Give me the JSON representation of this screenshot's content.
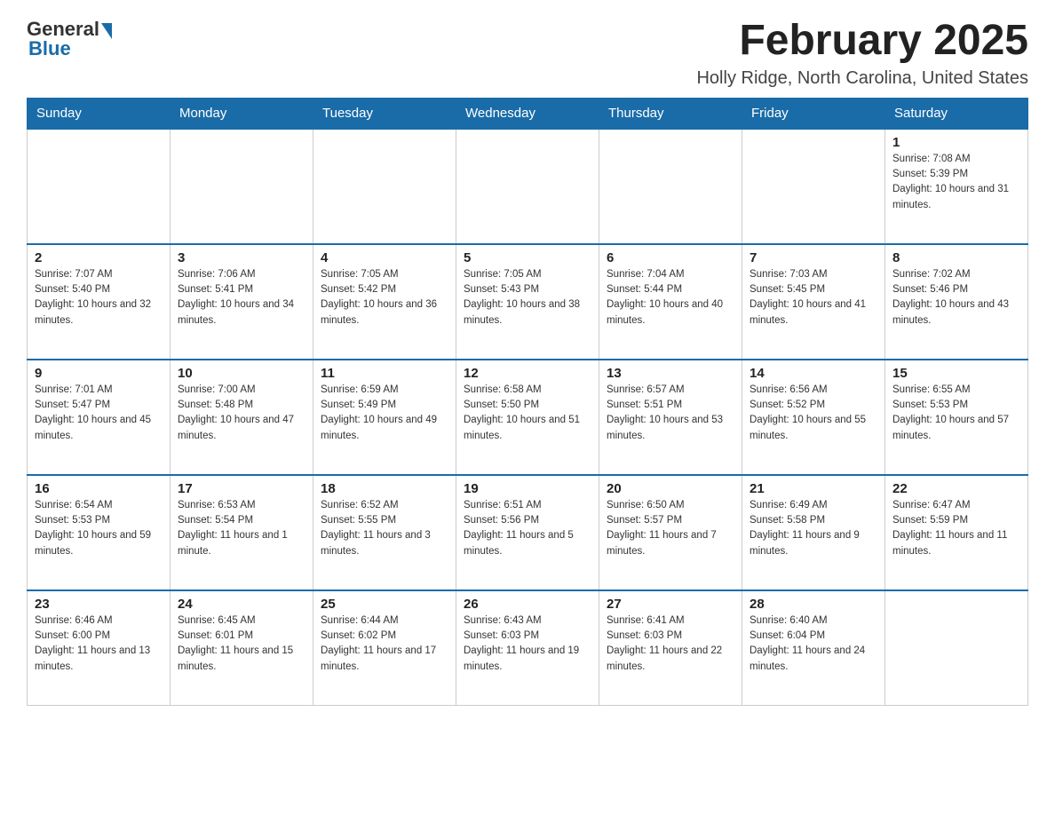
{
  "logo": {
    "general": "General",
    "blue": "Blue"
  },
  "header": {
    "month": "February 2025",
    "location": "Holly Ridge, North Carolina, United States"
  },
  "weekdays": [
    "Sunday",
    "Monday",
    "Tuesday",
    "Wednesday",
    "Thursday",
    "Friday",
    "Saturday"
  ],
  "weeks": [
    [
      {
        "day": "",
        "info": ""
      },
      {
        "day": "",
        "info": ""
      },
      {
        "day": "",
        "info": ""
      },
      {
        "day": "",
        "info": ""
      },
      {
        "day": "",
        "info": ""
      },
      {
        "day": "",
        "info": ""
      },
      {
        "day": "1",
        "info": "Sunrise: 7:08 AM\nSunset: 5:39 PM\nDaylight: 10 hours and 31 minutes."
      }
    ],
    [
      {
        "day": "2",
        "info": "Sunrise: 7:07 AM\nSunset: 5:40 PM\nDaylight: 10 hours and 32 minutes."
      },
      {
        "day": "3",
        "info": "Sunrise: 7:06 AM\nSunset: 5:41 PM\nDaylight: 10 hours and 34 minutes."
      },
      {
        "day": "4",
        "info": "Sunrise: 7:05 AM\nSunset: 5:42 PM\nDaylight: 10 hours and 36 minutes."
      },
      {
        "day": "5",
        "info": "Sunrise: 7:05 AM\nSunset: 5:43 PM\nDaylight: 10 hours and 38 minutes."
      },
      {
        "day": "6",
        "info": "Sunrise: 7:04 AM\nSunset: 5:44 PM\nDaylight: 10 hours and 40 minutes."
      },
      {
        "day": "7",
        "info": "Sunrise: 7:03 AM\nSunset: 5:45 PM\nDaylight: 10 hours and 41 minutes."
      },
      {
        "day": "8",
        "info": "Sunrise: 7:02 AM\nSunset: 5:46 PM\nDaylight: 10 hours and 43 minutes."
      }
    ],
    [
      {
        "day": "9",
        "info": "Sunrise: 7:01 AM\nSunset: 5:47 PM\nDaylight: 10 hours and 45 minutes."
      },
      {
        "day": "10",
        "info": "Sunrise: 7:00 AM\nSunset: 5:48 PM\nDaylight: 10 hours and 47 minutes."
      },
      {
        "day": "11",
        "info": "Sunrise: 6:59 AM\nSunset: 5:49 PM\nDaylight: 10 hours and 49 minutes."
      },
      {
        "day": "12",
        "info": "Sunrise: 6:58 AM\nSunset: 5:50 PM\nDaylight: 10 hours and 51 minutes."
      },
      {
        "day": "13",
        "info": "Sunrise: 6:57 AM\nSunset: 5:51 PM\nDaylight: 10 hours and 53 minutes."
      },
      {
        "day": "14",
        "info": "Sunrise: 6:56 AM\nSunset: 5:52 PM\nDaylight: 10 hours and 55 minutes."
      },
      {
        "day": "15",
        "info": "Sunrise: 6:55 AM\nSunset: 5:53 PM\nDaylight: 10 hours and 57 minutes."
      }
    ],
    [
      {
        "day": "16",
        "info": "Sunrise: 6:54 AM\nSunset: 5:53 PM\nDaylight: 10 hours and 59 minutes."
      },
      {
        "day": "17",
        "info": "Sunrise: 6:53 AM\nSunset: 5:54 PM\nDaylight: 11 hours and 1 minute."
      },
      {
        "day": "18",
        "info": "Sunrise: 6:52 AM\nSunset: 5:55 PM\nDaylight: 11 hours and 3 minutes."
      },
      {
        "day": "19",
        "info": "Sunrise: 6:51 AM\nSunset: 5:56 PM\nDaylight: 11 hours and 5 minutes."
      },
      {
        "day": "20",
        "info": "Sunrise: 6:50 AM\nSunset: 5:57 PM\nDaylight: 11 hours and 7 minutes."
      },
      {
        "day": "21",
        "info": "Sunrise: 6:49 AM\nSunset: 5:58 PM\nDaylight: 11 hours and 9 minutes."
      },
      {
        "day": "22",
        "info": "Sunrise: 6:47 AM\nSunset: 5:59 PM\nDaylight: 11 hours and 11 minutes."
      }
    ],
    [
      {
        "day": "23",
        "info": "Sunrise: 6:46 AM\nSunset: 6:00 PM\nDaylight: 11 hours and 13 minutes."
      },
      {
        "day": "24",
        "info": "Sunrise: 6:45 AM\nSunset: 6:01 PM\nDaylight: 11 hours and 15 minutes."
      },
      {
        "day": "25",
        "info": "Sunrise: 6:44 AM\nSunset: 6:02 PM\nDaylight: 11 hours and 17 minutes."
      },
      {
        "day": "26",
        "info": "Sunrise: 6:43 AM\nSunset: 6:03 PM\nDaylight: 11 hours and 19 minutes."
      },
      {
        "day": "27",
        "info": "Sunrise: 6:41 AM\nSunset: 6:03 PM\nDaylight: 11 hours and 22 minutes."
      },
      {
        "day": "28",
        "info": "Sunrise: 6:40 AM\nSunset: 6:04 PM\nDaylight: 11 hours and 24 minutes."
      },
      {
        "day": "",
        "info": ""
      }
    ]
  ]
}
